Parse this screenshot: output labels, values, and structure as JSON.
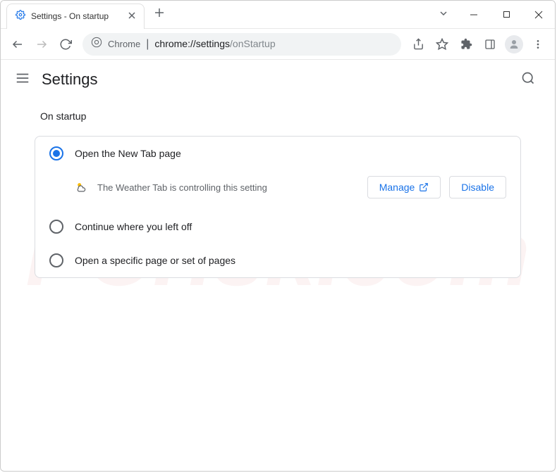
{
  "window": {
    "tab_title": "Settings - On startup"
  },
  "address": {
    "chip": "Chrome",
    "url_strong": "chrome://settings",
    "url_rest": "/onStartup"
  },
  "header": {
    "title": "Settings"
  },
  "section": {
    "title": "On startup",
    "options": [
      {
        "label": "Open the New Tab page",
        "selected": true
      },
      {
        "label": "Continue where you left off",
        "selected": false
      },
      {
        "label": "Open a specific page or set of pages",
        "selected": false
      }
    ],
    "extension_notice": "The Weather Tab is controlling this setting",
    "manage_label": "Manage",
    "disable_label": "Disable"
  }
}
